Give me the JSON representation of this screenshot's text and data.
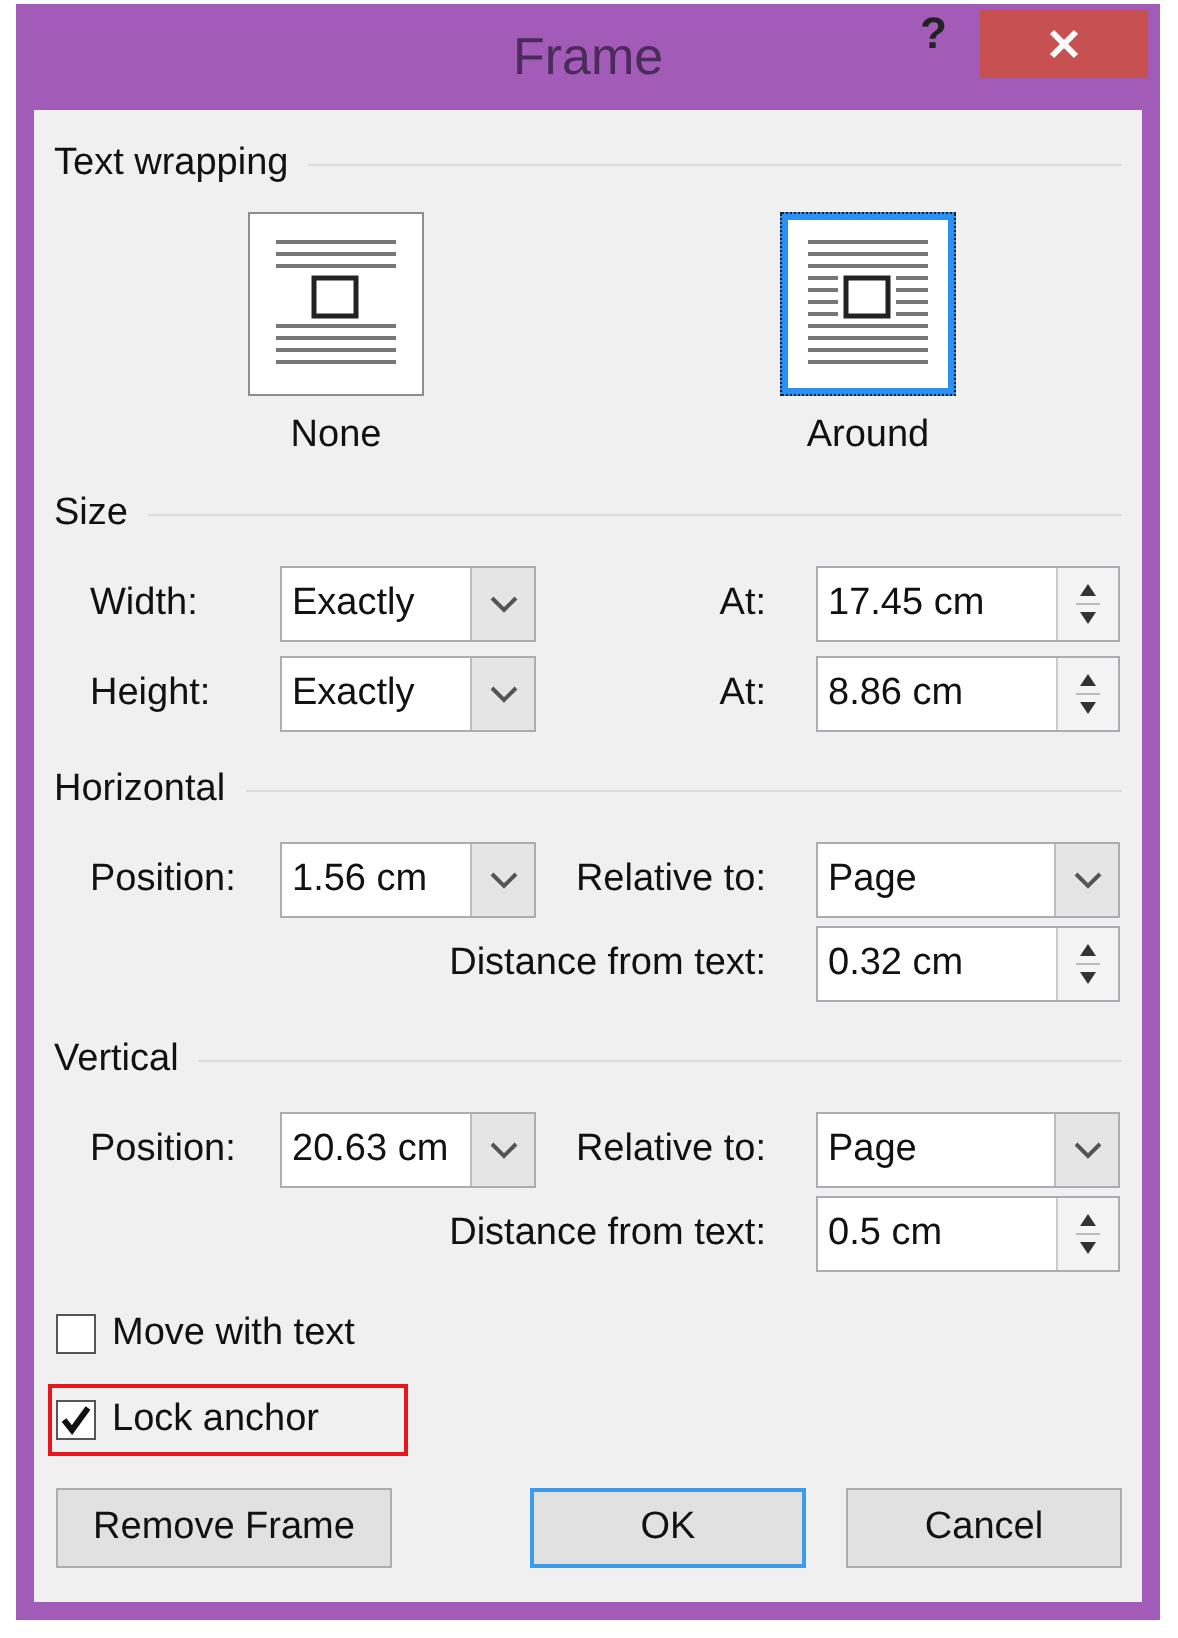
{
  "window": {
    "title": "Frame",
    "help": "?"
  },
  "text_wrapping": {
    "title": "Text wrapping",
    "options": [
      {
        "label": "None",
        "kind": "none",
        "selected": false
      },
      {
        "label": "Around",
        "kind": "around",
        "selected": true
      }
    ]
  },
  "size": {
    "title": "Size",
    "rows": [
      {
        "label": "Width:",
        "rule": "Exactly",
        "at_label": "At:",
        "at": "17.45 cm"
      },
      {
        "label": "Height:",
        "rule": "Exactly",
        "at_label": "At:",
        "at": "8.86 cm"
      }
    ]
  },
  "positions": [
    {
      "title": "Horizontal",
      "position_label": "Position:",
      "position": "1.56 cm",
      "relative_label": "Relative to:",
      "relative": "Page",
      "distance_label": "Distance from text:",
      "distance": "0.32 cm"
    },
    {
      "title": "Vertical",
      "position_label": "Position:",
      "position": "20.63 cm",
      "relative_label": "Relative to:",
      "relative": "Page",
      "distance_label": "Distance from text:",
      "distance": "0.5 cm"
    }
  ],
  "options": [
    {
      "label": "Move with text",
      "checked": false,
      "highlighted": false
    },
    {
      "label": "Lock anchor",
      "checked": true,
      "highlighted": true
    }
  ],
  "buttons": [
    {
      "label": "Remove Frame",
      "focused": false
    },
    {
      "label": "OK",
      "focused": true
    },
    {
      "label": "Cancel",
      "focused": false
    }
  ]
}
